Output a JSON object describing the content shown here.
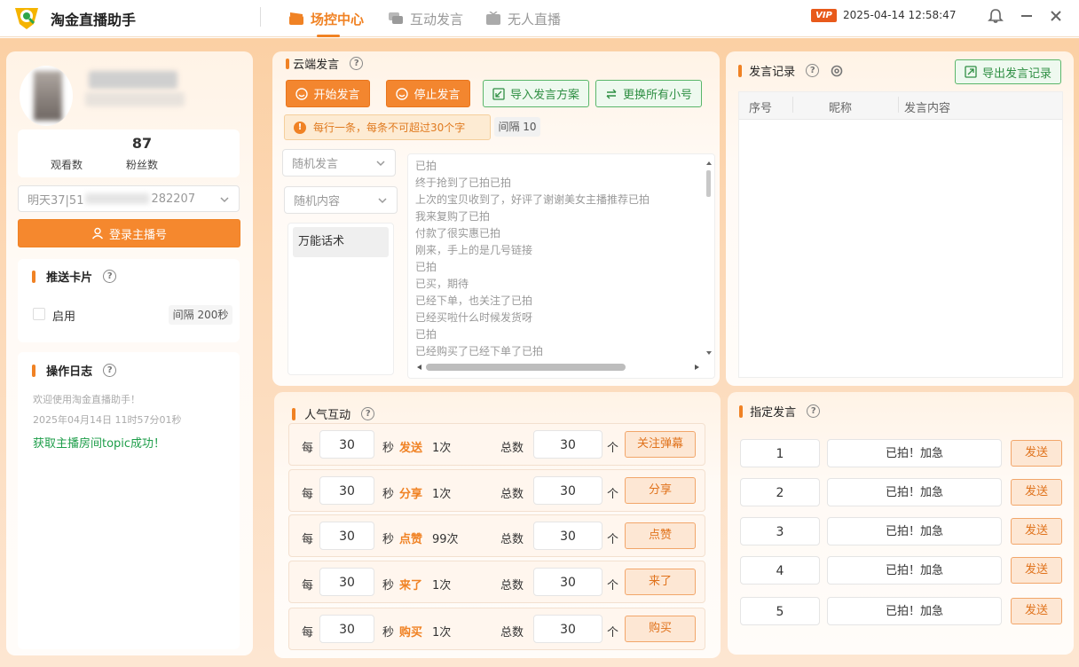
{
  "app": {
    "title": "淘金直播助手",
    "datetime": "2025-04-14 12:58:47",
    "vip": "VIP"
  },
  "tabs": [
    {
      "label": "场控中心",
      "active": true
    },
    {
      "label": "互动发言",
      "active": false
    },
    {
      "label": "无人直播",
      "active": false
    }
  ],
  "profile": {
    "viewers_value": "",
    "viewers_label": "观看数",
    "fans_value": "87",
    "fans_label": "粉丝数",
    "account_select": "明天37|51",
    "account_suffix": "282207",
    "login_button": "登录主播号"
  },
  "push_card": {
    "title": "推送卡片",
    "enable_label": "启用",
    "interval": "间隔 200秒"
  },
  "op_log": {
    "title": "操作日志",
    "lines": [
      "欢迎使用淘金直播助手！",
      "2025年04月14日 11时57分01秒",
      "获取主播房间topic成功！"
    ]
  },
  "cloud": {
    "title": "云端发言",
    "start": "开始发言",
    "stop": "停止发言",
    "import": "导入发言方案",
    "replace": "更换所有小号",
    "notice": "每行一条，每条不可超过30个字",
    "interval": "间隔 10",
    "mode_select": "随机发言",
    "content_select": "随机内容",
    "script_item": "万能话术",
    "messages": [
      "已拍",
      "终于抢到了已拍已拍",
      "上次的宝贝收到了，好评了谢谢美女主播推荐已拍",
      "我来复购了已拍",
      "付款了很实惠已拍",
      "刚来，手上的是几号链接",
      "已拍",
      "已买，期待",
      "已经下单，也关注了已拍",
      "已经买啦什么时候发货呀",
      "已拍",
      "已经购买了已经下单了已拍"
    ]
  },
  "record": {
    "title": "发言记录",
    "export": "导出发言记录",
    "columns": [
      "序号",
      "昵称",
      "发言内容"
    ]
  },
  "interact": {
    "title": "人气互动",
    "rows": [
      {
        "every": "每",
        "sec_value": "30",
        "sec_unit": "秒",
        "action": "发送",
        "times": "1次",
        "total_label": "总数",
        "total_value": "30",
        "unit": "个",
        "button": "关注弹幕"
      },
      {
        "every": "每",
        "sec_value": "30",
        "sec_unit": "秒",
        "action": "分享",
        "times": "1次",
        "total_label": "总数",
        "total_value": "30",
        "unit": "个",
        "button": "分享"
      },
      {
        "every": "每",
        "sec_value": "30",
        "sec_unit": "秒",
        "action": "点赞",
        "times": "99次",
        "total_label": "总数",
        "total_value": "30",
        "unit": "个",
        "button": "点赞"
      },
      {
        "every": "每",
        "sec_value": "30",
        "sec_unit": "秒",
        "action": "来了",
        "times": "1次",
        "total_label": "总数",
        "total_value": "30",
        "unit": "个",
        "button": "来了"
      },
      {
        "every": "每",
        "sec_value": "30",
        "sec_unit": "秒",
        "action": "购买",
        "times": "1次",
        "total_label": "总数",
        "total_value": "30",
        "unit": "个",
        "button": "购买"
      }
    ]
  },
  "designated": {
    "title": "指定发言",
    "rows": [
      {
        "no": "1",
        "text": "已拍！加急",
        "button": "发送"
      },
      {
        "no": "2",
        "text": "已拍！加急",
        "button": "发送"
      },
      {
        "no": "3",
        "text": "已拍！加急",
        "button": "发送"
      },
      {
        "no": "4",
        "text": "已拍！加急",
        "button": "发送"
      },
      {
        "no": "5",
        "text": "已拍！加急",
        "button": "发送"
      }
    ]
  },
  "colors": {
    "accent": "#f08224",
    "green": "#2f8f43",
    "log_success": "#1e9e4a"
  }
}
